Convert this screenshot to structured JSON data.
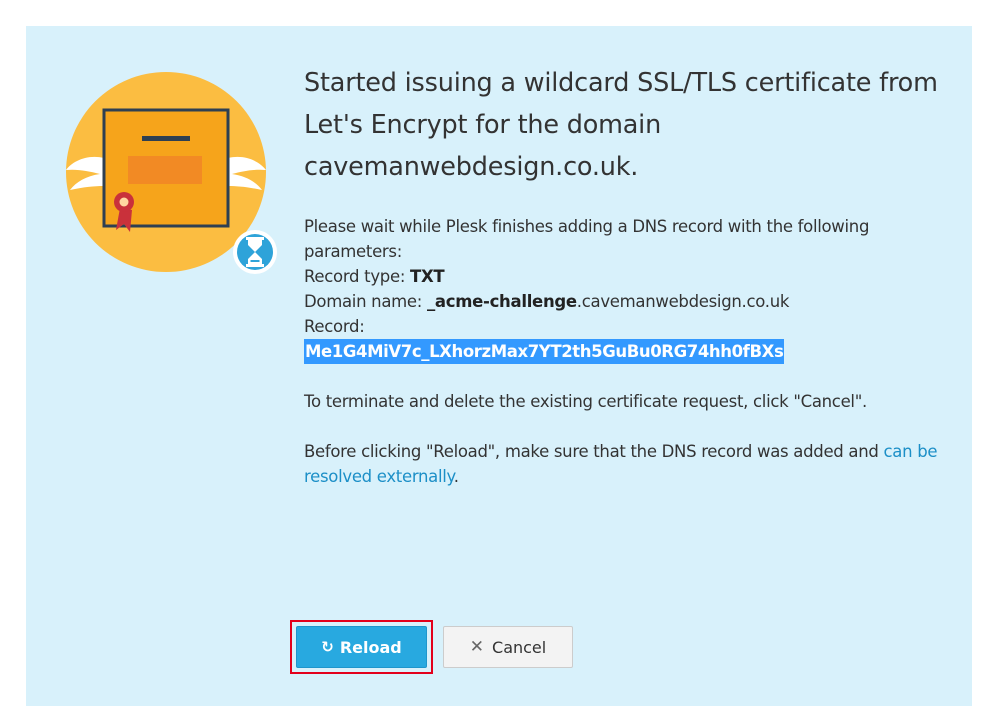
{
  "dialog": {
    "title": "Started issuing a wildcard SSL/TLS certificate from Let's Encrypt for the domain cavemanwebdesign.co.uk.",
    "illustration_icon": "certificate-with-wings-icon",
    "status_icon": "hourglass-icon"
  },
  "message": {
    "intro": "Please wait while Plesk finishes adding a DNS record with the following parameters:",
    "record_type_label": "Record type:",
    "record_type_value": "TXT",
    "domain_name_label": "Domain name:",
    "domain_name_prefix": "_acme-challenge",
    "domain_name_suffix": ".cavemanwebdesign.co.uk",
    "record_label": "Record:",
    "record_value": "Me1G4MiV7c_LXhorzMax7YT2th5GuBu0RG74hh0fBXs",
    "cancel_hint": "To terminate and delete the existing certificate request, click \"Cancel\".",
    "reload_hint_before": "Before clicking \"Reload\", make sure that the DNS record was added and ",
    "reload_hint_link": "can be resolved externally",
    "reload_hint_after": "."
  },
  "actions": {
    "reload_label": "Reload",
    "reload_icon": "reload-icon",
    "cancel_label": "Cancel",
    "cancel_icon": "close-icon"
  },
  "colors": {
    "panel_background": "#d8f1fb",
    "primary_button": "#28a9e0",
    "link": "#1c8fc7",
    "selection_highlight": "#3399ff",
    "annotation_border": "#e3001b"
  }
}
